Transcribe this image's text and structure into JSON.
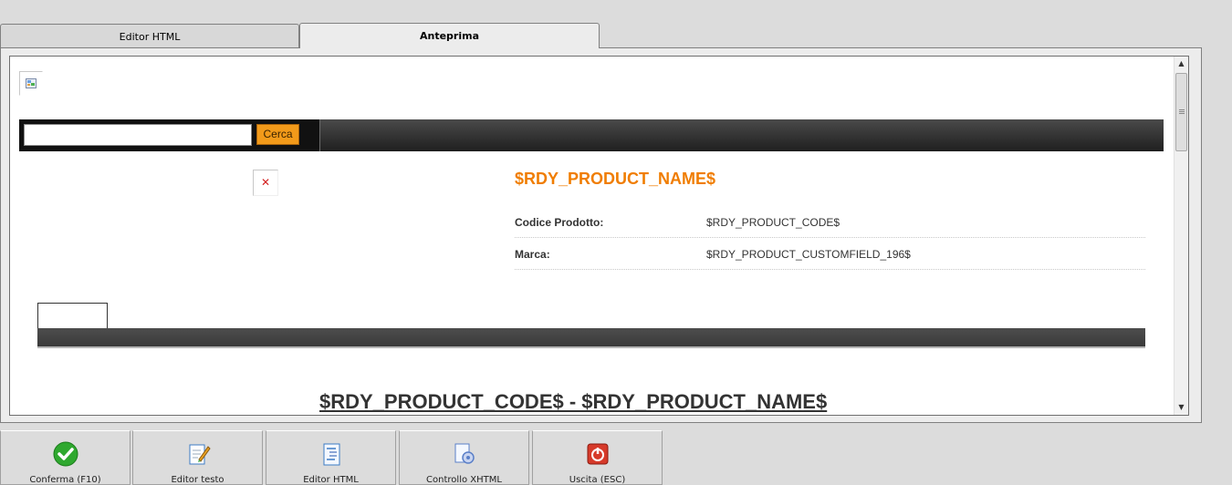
{
  "tabs": [
    {
      "label": "Editor HTML"
    },
    {
      "label": "Anteprima"
    }
  ],
  "preview": {
    "search": {
      "value": "",
      "button_label": "Cerca"
    },
    "product_name": "$RDY_PRODUCT_NAME$",
    "info_rows": [
      {
        "key": "Codice Prodotto:",
        "value": "$RDY_PRODUCT_CODE$"
      },
      {
        "key": "Marca:",
        "value": "$RDY_PRODUCT_CUSTOMFIELD_196$"
      }
    ],
    "big_title": "$RDY_PRODUCT_CODE$ - $RDY_PRODUCT_NAME$"
  },
  "bottom_buttons": [
    {
      "label": "Conferma (F10)",
      "icon": "check-icon",
      "color": "#2fa82f"
    },
    {
      "label": "Editor testo",
      "icon": "edit-document-icon",
      "color": "#3d7bc4"
    },
    {
      "label": "Editor HTML",
      "icon": "html-document-icon",
      "color": "#3d7bc4"
    },
    {
      "label": "Controllo XHTML",
      "icon": "settings-document-icon",
      "color": "#5a7fc8"
    },
    {
      "label": "Uscita (ESC)",
      "icon": "exit-icon",
      "color": "#d63a2a"
    }
  ],
  "colors": {
    "accent_orange": "#f07d00",
    "search_button": "#f29a1a",
    "dark_bar": "#333333"
  }
}
